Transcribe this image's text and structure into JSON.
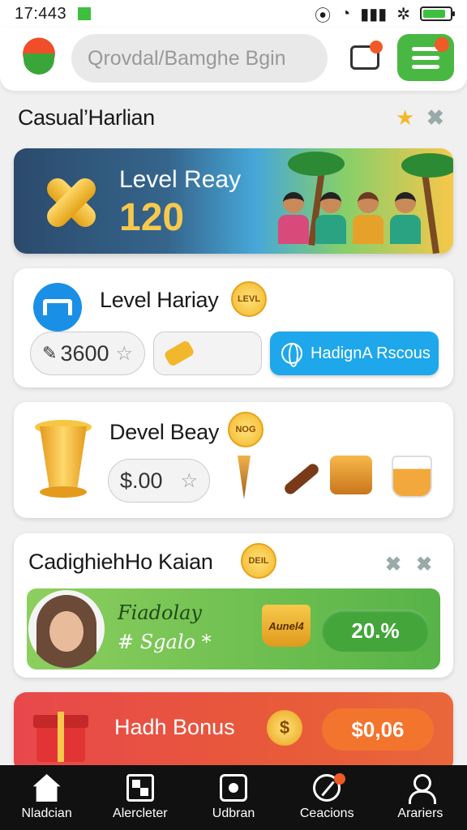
{
  "status": {
    "time": "17:443"
  },
  "header": {
    "search_placeholder": "Qrovdal/Bamghe Bgin"
  },
  "section": {
    "title": "Casual’Harlian"
  },
  "banner": {
    "title": "Level Reay",
    "value": "120"
  },
  "card1": {
    "title": "Level Hariay",
    "badge": "LEVL",
    "amount": "3600",
    "button": "HadignA Rscous"
  },
  "card2": {
    "title": "Devel Beay",
    "badge": "NOG",
    "amount": "$.00"
  },
  "card3": {
    "title": "CadighiehHo Kaian",
    "badge": "DEIL",
    "script1": "Fiadolay",
    "script2": "# Sgalo *",
    "bucket_label": "Aunel4",
    "percent": "20.%"
  },
  "card4": {
    "title": "Hadh Bonus",
    "amount": "$0,06"
  },
  "nav": {
    "items": [
      {
        "label": "Nladcian",
        "icon": "home-icon"
      },
      {
        "label": "Alercleter",
        "icon": "grid-icon"
      },
      {
        "label": "Udbran",
        "icon": "gear-icon"
      },
      {
        "label": "Ceacions",
        "icon": "compass-icon"
      },
      {
        "label": "Arariers",
        "icon": "person-icon"
      }
    ]
  },
  "colors": {
    "accent_green": "#49b842",
    "accent_blue": "#1ea7ea",
    "accent_orange": "#f3742d",
    "notification": "#f05a28"
  }
}
